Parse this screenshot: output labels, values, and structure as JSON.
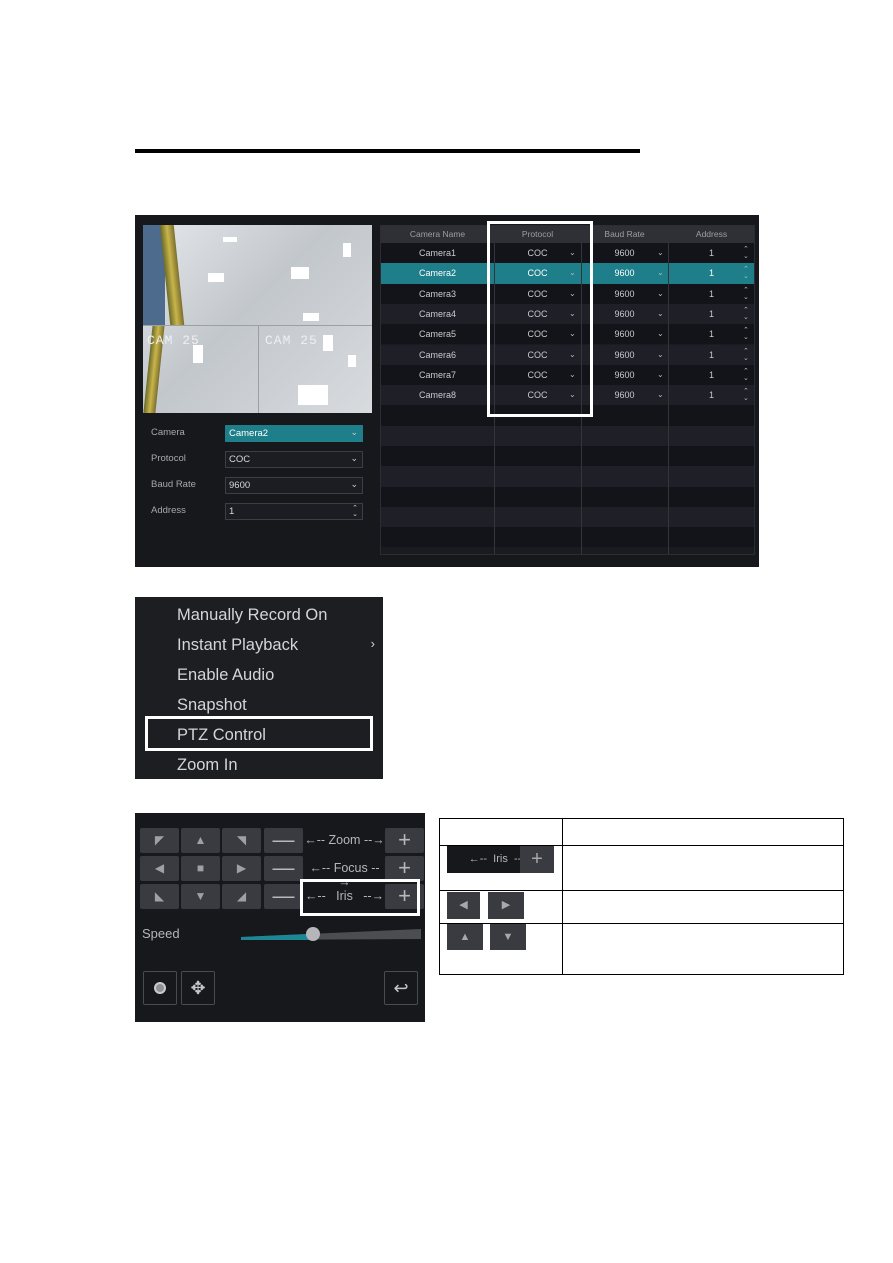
{
  "panel_camera_setup": {
    "preview": {
      "overlay_labels": [
        "CAM 25",
        "CAM 25"
      ]
    },
    "form": {
      "fields": [
        {
          "label": "Camera",
          "value": "Camera2",
          "control": "dropdown",
          "selected": true
        },
        {
          "label": "Protocol",
          "value": "COC",
          "control": "dropdown"
        },
        {
          "label": "Baud Rate",
          "value": "9600",
          "control": "dropdown"
        },
        {
          "label": "Address",
          "value": "1",
          "control": "spinner"
        }
      ]
    },
    "table": {
      "columns": [
        "Camera Name",
        "Protocol",
        "Baud Rate",
        "Address"
      ],
      "rows": [
        {
          "camera_name": "Camera1",
          "protocol": "COC",
          "baud_rate": "9600",
          "address": "1"
        },
        {
          "camera_name": "Camera2",
          "protocol": "COC",
          "baud_rate": "9600",
          "address": "1",
          "selected": true
        },
        {
          "camera_name": "Camera3",
          "protocol": "COC",
          "baud_rate": "9600",
          "address": "1"
        },
        {
          "camera_name": "Camera4",
          "protocol": "COC",
          "baud_rate": "9600",
          "address": "1"
        },
        {
          "camera_name": "Camera5",
          "protocol": "COC",
          "baud_rate": "9600",
          "address": "1"
        },
        {
          "camera_name": "Camera6",
          "protocol": "COC",
          "baud_rate": "9600",
          "address": "1"
        },
        {
          "camera_name": "Camera7",
          "protocol": "COC",
          "baud_rate": "9600",
          "address": "1"
        },
        {
          "camera_name": "Camera8",
          "protocol": "COC",
          "baud_rate": "9600",
          "address": "1"
        }
      ],
      "highlighted_column": "Protocol"
    },
    "colors": {
      "accent": "#1e7f8a",
      "panel_bg": "#17181c",
      "highlight_box": "#ffffff"
    }
  },
  "context_menu": {
    "items": [
      {
        "label": "Manually Record On"
      },
      {
        "label": "Instant Playback",
        "has_submenu": true
      },
      {
        "label": "Enable Audio"
      },
      {
        "label": "Snapshot"
      },
      {
        "label": "PTZ Control",
        "highlighted": true
      },
      {
        "label": "Zoom In"
      }
    ],
    "submenu_glyph": "›"
  },
  "ptz_panel": {
    "direction_icons": [
      "arrow-up-left",
      "arrow-up",
      "arrow-up-right",
      "arrow-left",
      "stop-square",
      "arrow-right",
      "arrow-down-left",
      "arrow-down",
      "arrow-down-right"
    ],
    "adjust_rows": [
      {
        "label": "Zoom",
        "minus": "—",
        "plus": "+"
      },
      {
        "label": "Focus",
        "minus": "—",
        "plus": "+"
      },
      {
        "label": "Iris",
        "minus": "—",
        "plus": "+",
        "highlighted": true
      }
    ],
    "arrow_left": "←--",
    "arrow_right": "--→",
    "speed_label": "Speed",
    "speed_value_percent": 40,
    "bottom_buttons": [
      "record-dot",
      "move-cross",
      "back-return"
    ]
  },
  "legend_table": {
    "rows": [
      {
        "icon_group": "header",
        "description": ""
      },
      {
        "icon_group": "iris-plus",
        "iris_label": "Iris",
        "description": ""
      },
      {
        "icon_group": "left-right",
        "description": ""
      },
      {
        "icon_group": "up-down",
        "description": ""
      }
    ]
  }
}
